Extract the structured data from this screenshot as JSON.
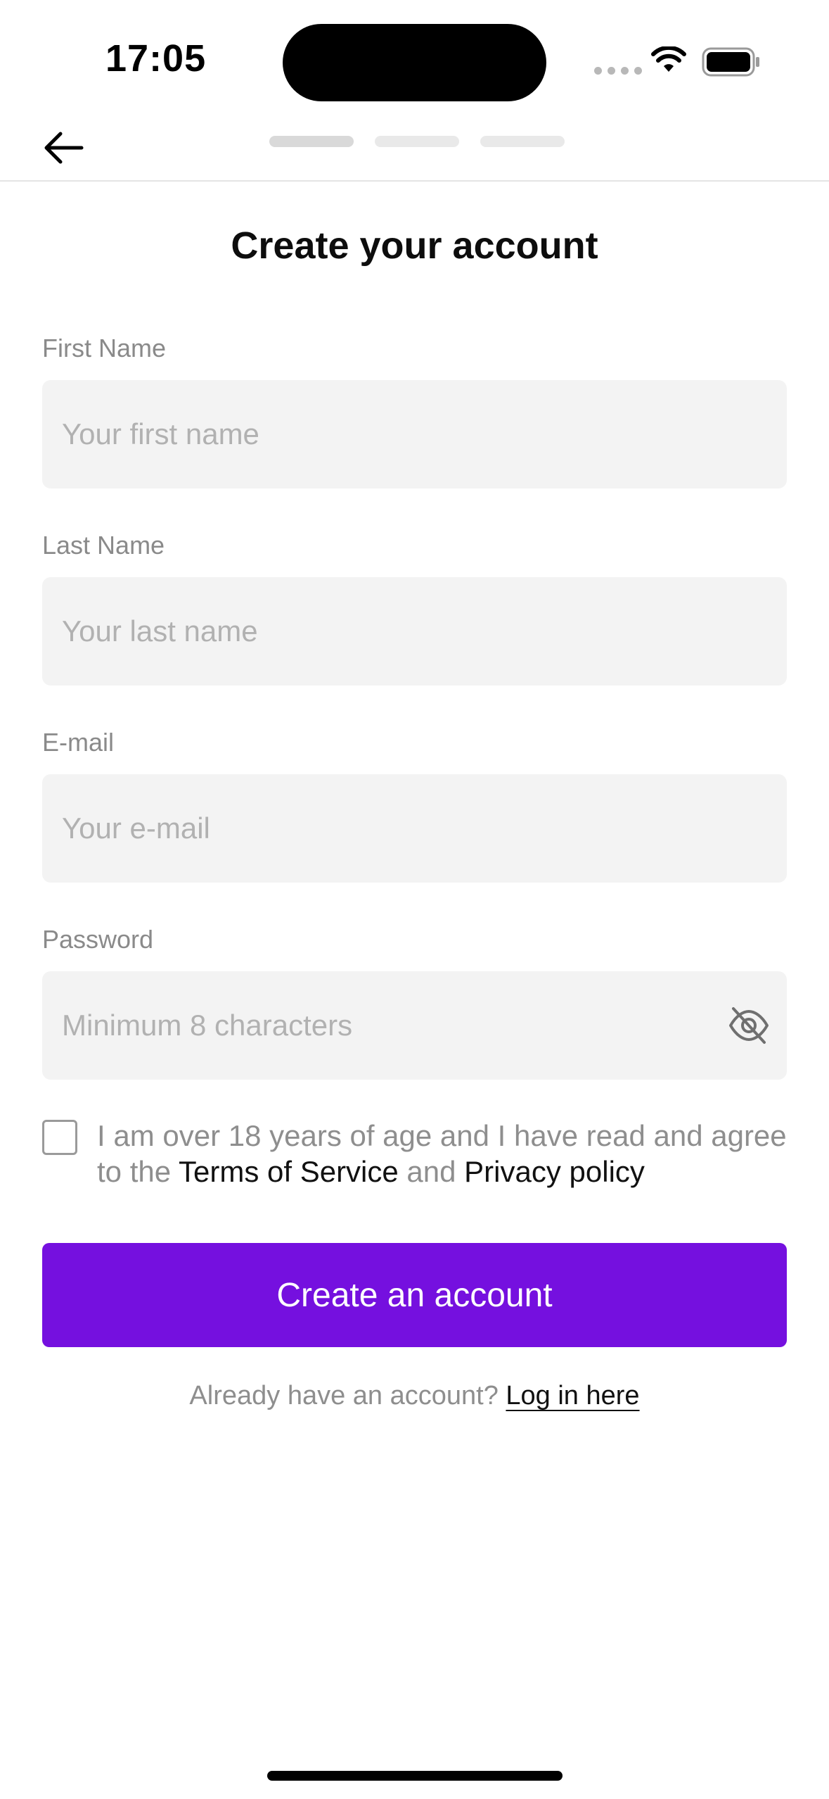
{
  "status_bar": {
    "time": "17:05"
  },
  "icons": {
    "back": "arrow-left-icon",
    "wifi": "wifi-icon",
    "battery": "battery-icon",
    "signal": "signal-dots-icon",
    "password_toggle": "eye-off-icon"
  },
  "progress": {
    "total_steps": 3,
    "current_step": 1
  },
  "page": {
    "title": "Create your account"
  },
  "form": {
    "first_name": {
      "label": "First Name",
      "placeholder": "Your first name",
      "value": ""
    },
    "last_name": {
      "label": "Last Name",
      "placeholder": "Your last name",
      "value": ""
    },
    "email": {
      "label": "E-mail",
      "placeholder": "Your e-mail",
      "value": ""
    },
    "password": {
      "label": "Password",
      "placeholder": "Minimum 8 characters",
      "value": ""
    },
    "terms": {
      "checked": false,
      "text_part1": "I am over 18 years of age and I have read and agree to the ",
      "terms_link": "Terms of Service",
      "text_part2": " and ",
      "privacy_link": "Privacy policy"
    },
    "submit_label": "Create an account"
  },
  "login": {
    "prompt": "Already have an account?",
    "link": "Log in here"
  },
  "colors": {
    "primary": "#7510df",
    "field_background": "#f3f3f3",
    "label": "#8a8a8a",
    "placeholder": "#b1b1b1"
  }
}
